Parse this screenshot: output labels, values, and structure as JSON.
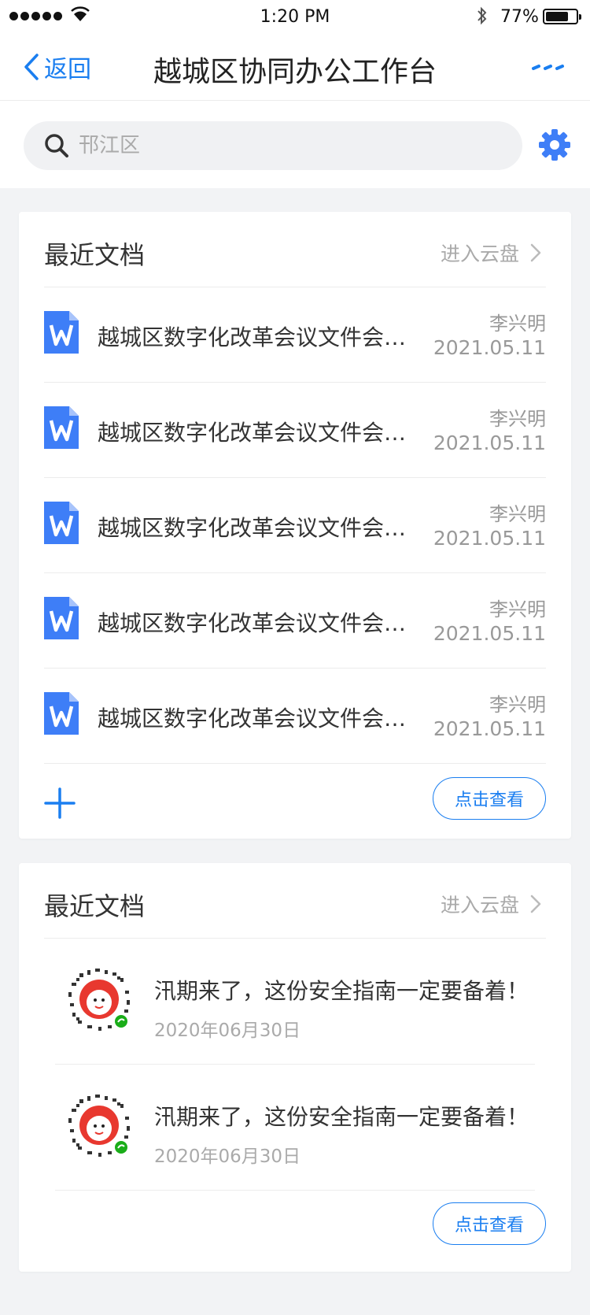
{
  "status_bar": {
    "time": "1:20 PM",
    "battery": "77%",
    "battery_level": 0.77
  },
  "nav": {
    "back_label": "返回",
    "title": "越城区协同办公工作台",
    "more_icon": "more-dots-icon"
  },
  "search": {
    "placeholder": "邗江区",
    "value": ""
  },
  "documents_card": {
    "title": "最近文档",
    "enter_link": "进入云盘",
    "items": [
      {
        "name": "越城区数字化改革会议文件会议文件",
        "author": "李兴明",
        "date": "2021.05.11"
      },
      {
        "name": "越城区数字化改革会议文件会议文件",
        "author": "李兴明",
        "date": "2021.05.11"
      },
      {
        "name": "越城区数字化改革会议文件会议文件",
        "author": "李兴明",
        "date": "2021.05.11"
      },
      {
        "name": "越城区数字化改革会议文件会议文件",
        "author": "李兴明",
        "date": "2021.05.11"
      },
      {
        "name": "越城区数字化改革会议文件会议文件",
        "author": "李兴明",
        "date": "2021.05.11"
      }
    ],
    "view_button": "点击查看"
  },
  "articles_card": {
    "title": "最近文档",
    "enter_link": "进入云盘",
    "items": [
      {
        "title": "汛期来了，这份安全指南一定要备着！",
        "date": "2020年06月30日"
      },
      {
        "title": "汛期来了，这份安全指南一定要备着！",
        "date": "2020年06月30日"
      }
    ],
    "view_button": "点击查看"
  },
  "colors": {
    "accent": "#1a7ef0",
    "doc_icon": "#3e7ef7",
    "background": "#f2f3f5"
  }
}
